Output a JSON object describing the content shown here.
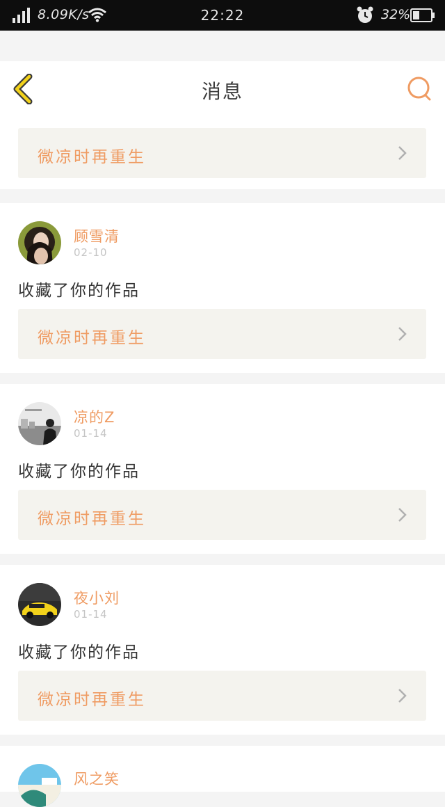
{
  "status_bar": {
    "speed": "8.09K/s",
    "time": "22:22",
    "battery": "32%"
  },
  "header": {
    "title": "消息"
  },
  "top_card": {
    "work_title": "微凉时再重生"
  },
  "messages": [
    {
      "user": "顾雪清",
      "date": "02-10",
      "action": "收藏了你的作品",
      "work_title": "微凉时再重生"
    },
    {
      "user": "凉的Z",
      "date": "01-14",
      "action": "收藏了你的作品",
      "work_title": "微凉时再重生"
    },
    {
      "user": "夜小刘",
      "date": "01-14",
      "action": "收藏了你的作品",
      "work_title": "微凉时再重生"
    },
    {
      "user": "风之笑"
    }
  ],
  "colors": {
    "accent": "#ef9b62",
    "back_arrow": "#f2d21b"
  }
}
